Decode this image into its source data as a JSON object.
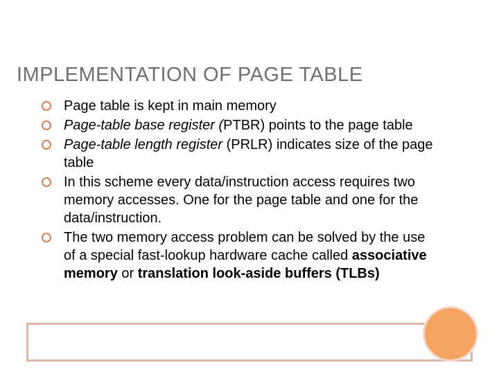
{
  "title": "IMPLEMENTATION OF PAGE TABLE",
  "bullets": {
    "b0": "Page table is kept in main memory",
    "b1_i": "Page-table base register (",
    "b1_a": "PTBR) points to the page table",
    "b2_i": "Page-table length register",
    "b2_a": " (PRLR) indicates size of the page table",
    "b3": "In this scheme every data/instruction access requires two memory accesses.  One for the page table and one for the data/instruction.",
    "b4_a": "The two memory access problem can be solved by the use of a special fast-lookup hardware cache called ",
    "b4_b1": "associative memory",
    "b4_mid": " or ",
    "b4_b2": "translation look-aside buffers (TLBs)"
  }
}
